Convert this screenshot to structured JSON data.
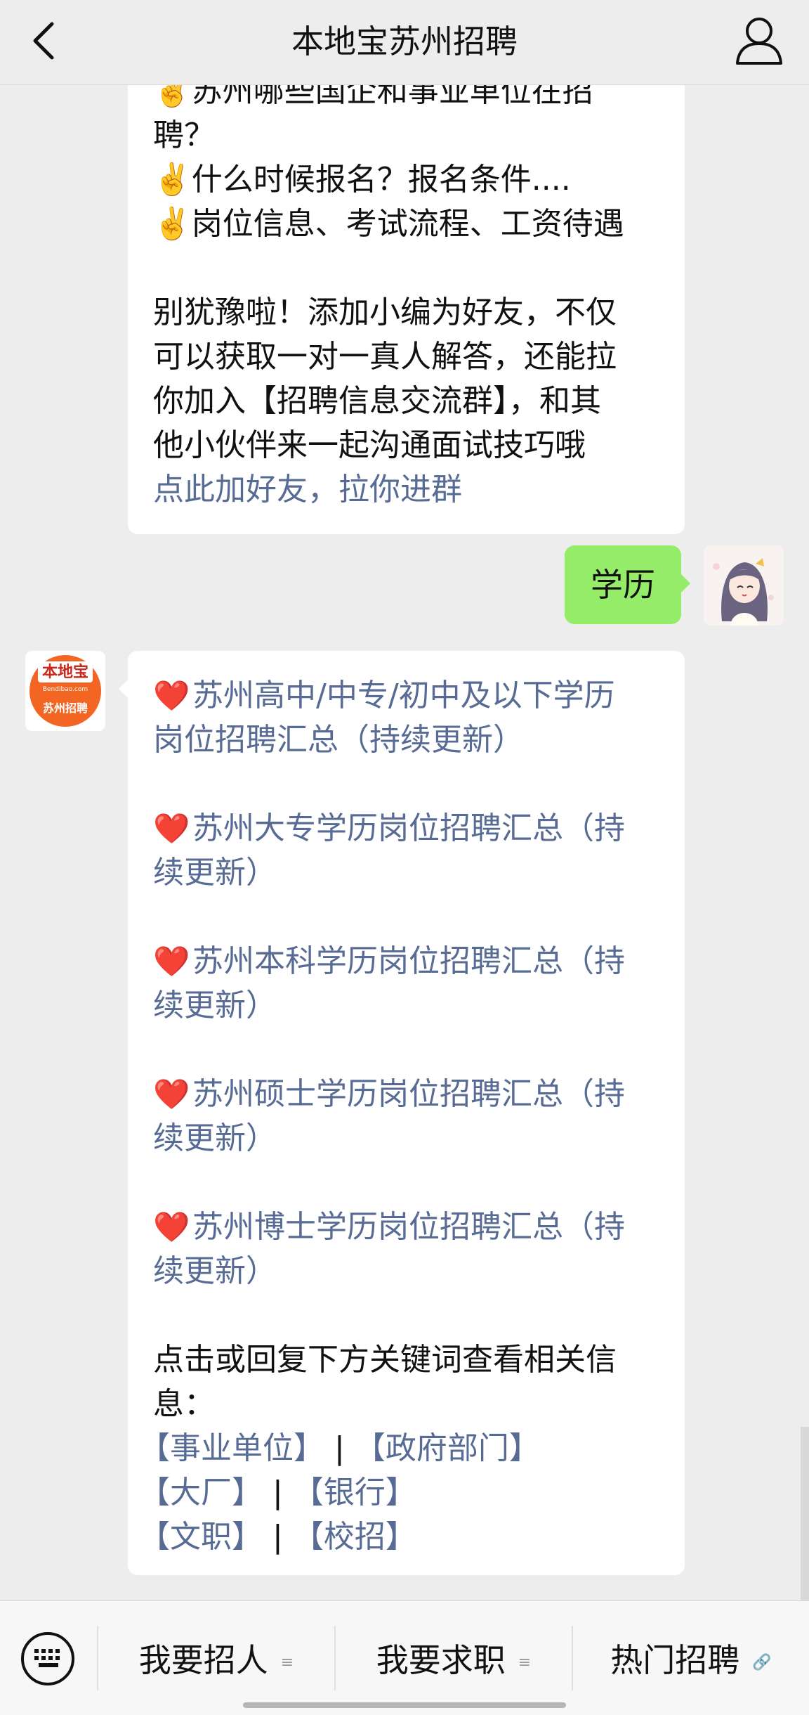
{
  "header": {
    "title": "本地宝苏州招聘",
    "back_icon": "chevron-left-icon",
    "profile_icon": "person-icon"
  },
  "message1": {
    "lines": [
      "✌️苏州哪些国企和事业单位在招",
      "聘？",
      "✌️什么时候报名？报名条件....",
      "✌️岗位信息、考试流程、工资待遇",
      "",
      "别犹豫啦！添加小编为好友，不仅",
      "可以获取一对一真人解答，还能拉",
      "你加入【招聘信息交流群】，和其",
      "他小伙伴来一起沟通面试技巧哦"
    ],
    "link": "点此加好友，拉你进群"
  },
  "my_message": {
    "text": "学历",
    "avatar": "anime-girl-avatar"
  },
  "bot_avatar": {
    "brand": "本地宝",
    "domain": "Bendibao.com",
    "caption": "苏州招聘"
  },
  "message2": {
    "heart": "❤️",
    "items": [
      [
        "苏州高中/中专/初中及以下学历",
        "岗位招聘汇总（持续更新）"
      ],
      [
        "苏州大专学历岗位招聘汇总（持",
        "续更新）"
      ],
      [
        "苏州本科学历岗位招聘汇总（持",
        "续更新）"
      ],
      [
        "苏州硕士学历岗位招聘汇总（持",
        "续更新）"
      ],
      [
        "苏州博士学历岗位招聘汇总（持",
        "续更新）"
      ]
    ],
    "prompt_line1": "点击或回复下方关键词查看相关信",
    "prompt_line2": "息：",
    "separator": "|",
    "keywords": {
      "shiye": "【事业单位】",
      "zhengfu": "【政府部门】",
      "dachang": "【大厂】",
      "yinhang": "【银行】",
      "wenzhi": "【文职】",
      "xiaozhao": "【校招】"
    }
  },
  "bottom_menu": {
    "keyboard_icon": "keyboard-icon",
    "items": [
      {
        "label": "我要招人",
        "icon": "≡"
      },
      {
        "label": "我要求职",
        "icon": "≡"
      },
      {
        "label": "热门招聘",
        "icon": "🔗"
      }
    ]
  },
  "colors": {
    "background": "#ededed",
    "link": "#576b95",
    "my_bubble": "#95ec69",
    "heart": "#e0201e"
  }
}
